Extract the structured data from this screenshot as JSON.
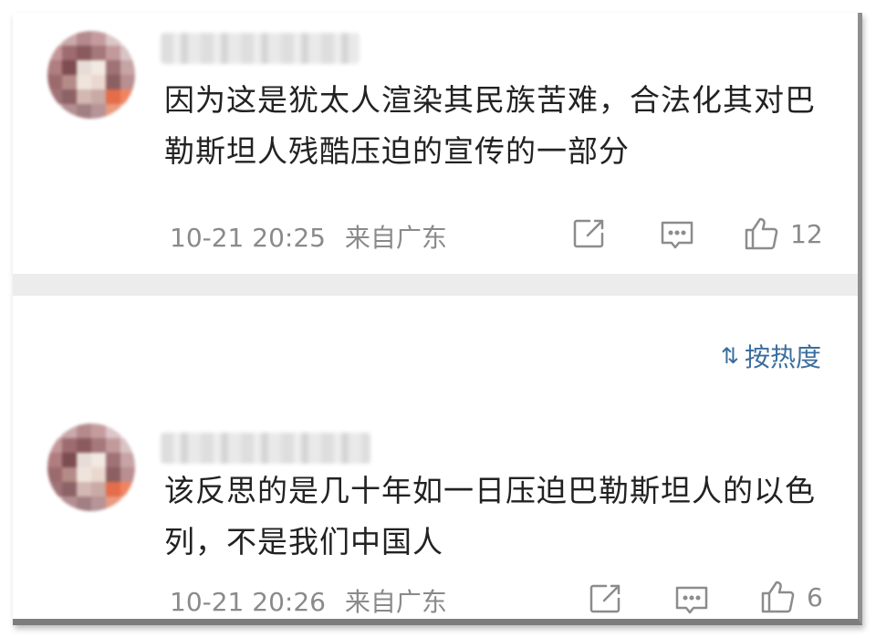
{
  "comments": [
    {
      "text": "因为这是犹太人渲染其民族苦难，合法化其对巴勒斯坦人残酷压迫的宣传的一部分",
      "date": "10-21 20:25",
      "location": "来自广东",
      "likes": "12"
    },
    {
      "text": "该反思的是几十年如一日压迫巴勒斯坦人的以色列，不是我们中国人",
      "date": "10-21 20:26",
      "location": "来自广东",
      "likes": "6"
    }
  ],
  "sort": {
    "icon": "sort-icon",
    "label": "按热度"
  },
  "icons": [
    "share-icon",
    "comment-icon",
    "like-icon"
  ],
  "colors": {
    "text": "#222222",
    "meta": "#8a8a8a",
    "accent": "#3b6e9e",
    "divider": "#ececec"
  }
}
